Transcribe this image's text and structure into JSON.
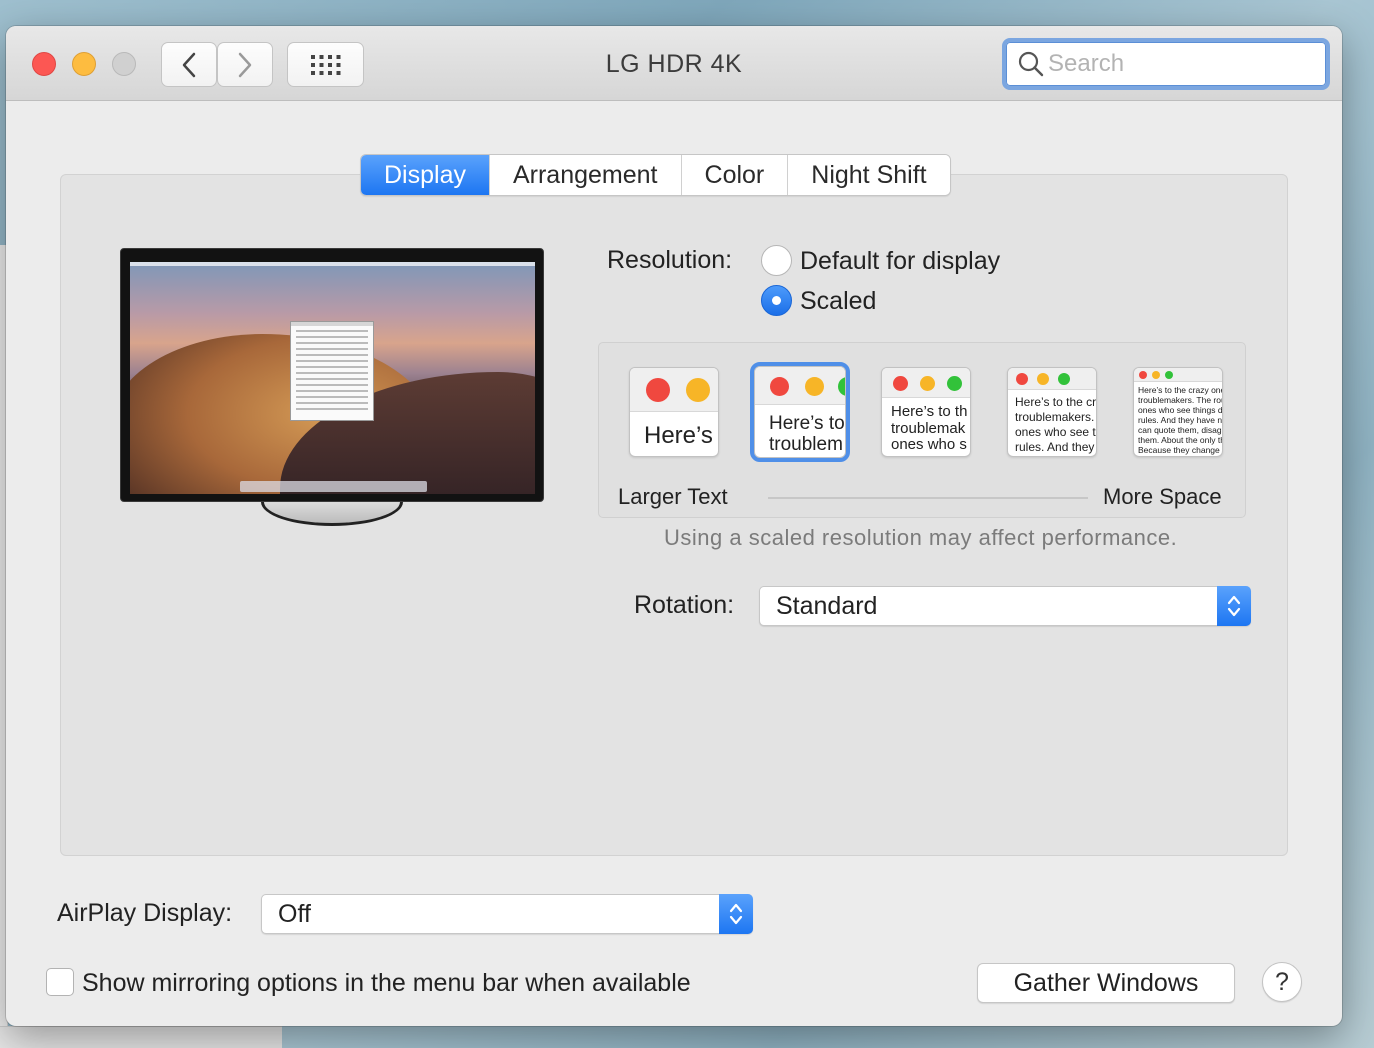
{
  "window": {
    "title": "LG HDR 4K"
  },
  "search": {
    "placeholder": "Search"
  },
  "tabs": [
    {
      "label": "Display",
      "active": true
    },
    {
      "label": "Arrangement",
      "active": false
    },
    {
      "label": "Color",
      "active": false
    },
    {
      "label": "Night Shift",
      "active": false
    }
  ],
  "resolution": {
    "label": "Resolution:",
    "options": [
      {
        "label": "Default for display",
        "selected": false
      },
      {
        "label": "Scaled",
        "selected": true
      }
    ]
  },
  "scaling": {
    "thumbnails": [
      {
        "text": "Here’s",
        "selected": false
      },
      {
        "text": "Here’s to\ntroublem",
        "selected": true
      },
      {
        "text": "Here’s to th\ntroublemak\nones who s",
        "selected": false
      },
      {
        "text": "Here’s to the cr\ntroublemakers.\nones who see t\nrules. And they",
        "selected": false
      },
      {
        "text": "Here’s to the crazy one\ntroublemakers. The rou\nones who see things di\nrules. And they have no\ncan quote them, disagr\nthem. About the only th\nBecause they change t",
        "selected": false
      }
    ],
    "left_label": "Larger Text",
    "right_label": "More Space",
    "note": "Using a scaled resolution may affect performance."
  },
  "rotation": {
    "label": "Rotation:",
    "value": "Standard"
  },
  "airplay": {
    "label": "AirPlay Display:",
    "value": "Off"
  },
  "mirroring": {
    "label": "Show mirroring options in the menu bar when available",
    "checked": false
  },
  "buttons": {
    "gather": "Gather Windows",
    "help": "?"
  },
  "colors": {
    "accent": "#1d76f2",
    "close": "#fc5753",
    "minimize": "#fdbc40"
  }
}
